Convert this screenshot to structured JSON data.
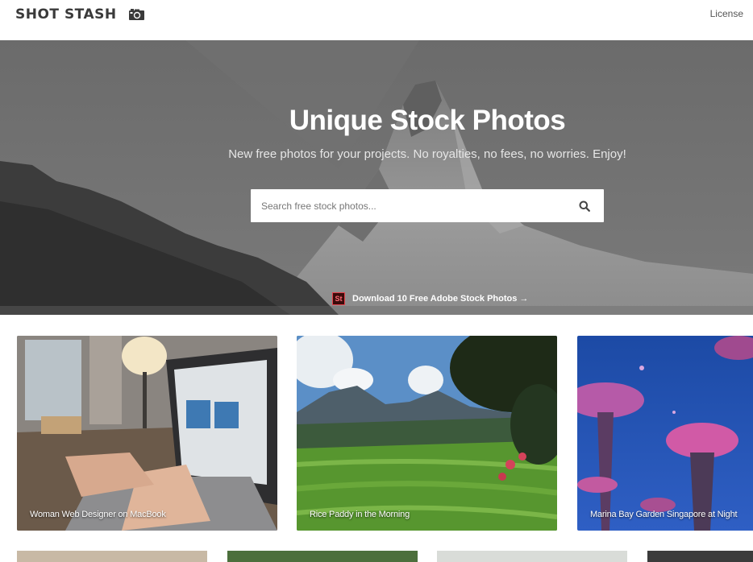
{
  "header": {
    "logo_text": "SHOT STASH",
    "logo_icon": "camera-icon",
    "license_link": "License"
  },
  "hero": {
    "title": "Unique Stock Photos",
    "subtitle": "New free photos for your projects. No royalties, no fees, no worries. Enjoy!",
    "search_placeholder": "Search free stock photos...",
    "search_icon": "search-icon",
    "promo_badge": "St",
    "promo_text": "Download 10 Free Adobe Stock Photos →"
  },
  "photos": [
    {
      "caption": "Woman Web Designer on MacBook"
    },
    {
      "caption": "Rice Paddy in the Morning"
    },
    {
      "caption": "Marina Bay Garden Singapore at Night"
    }
  ],
  "colors": {
    "hero_overlay": "#5b5b5b",
    "promo_badge_border": "#e3414b",
    "text_dark": "#3a3a3a"
  }
}
